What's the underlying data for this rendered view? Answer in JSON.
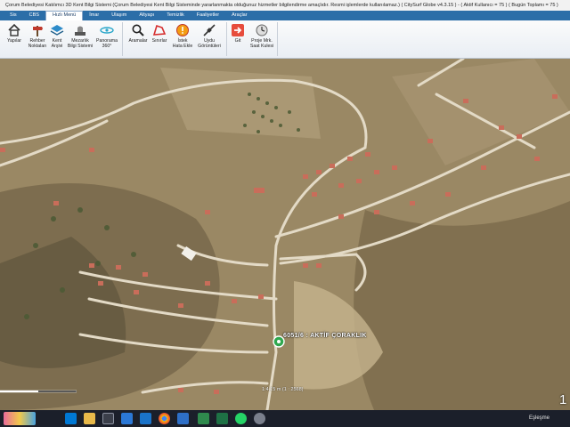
{
  "window": {
    "title": "Çorum Belediyesi Katılımcı 3D Kent Bilgi Sistemi (Çorum Belediyesi Kent Bilgi Sisteminde yararlanmakta olduğunuz hizmetler bilgilendirme amaçlıdır. Resmi işlemlerde kullanılamaz.)  ( CitySurf Globe v4.3.15 ) - ( Aktif Kullanıcı = 75 )  ( Bugün Toplamı = 75 )"
  },
  "menu": {
    "items": [
      "Sis",
      "CBS",
      "Hızlı Menü",
      "İmar",
      "Ulaşım",
      "Altyapı",
      "Temizlik",
      "Faaliyetler",
      "Araçlar"
    ],
    "active_index": 2
  },
  "ribbon": {
    "buttons": [
      {
        "label": "Yapılar",
        "icon": "house-icon"
      },
      {
        "label": "Rehber\nNoktaları",
        "icon": "signpost-icon"
      },
      {
        "label": "Kent\nArşivi",
        "icon": "layers-icon"
      },
      {
        "label": "Mezarlık\nBilgi Sistemi",
        "icon": "cemetery-icon"
      },
      {
        "label": "Panorama\n360°",
        "icon": "panorama-icon"
      },
      {
        "label": "Aramalar",
        "icon": "magnifier-icon"
      },
      {
        "label": "Sınırlar",
        "icon": "boundary-icon"
      },
      {
        "label": "İstek\nHata Ekle",
        "icon": "warning-icon"
      },
      {
        "label": "Uydu\nGörüntüleri",
        "icon": "satellite-icon"
      },
      {
        "label": "Git",
        "icon": "goto-arrow-icon"
      },
      {
        "label": "Proje Mrk.\nSaat Kulesi",
        "icon": "clock-tower-icon"
      }
    ]
  },
  "map": {
    "marker_label": "6051/6 : AKTİF ÇORAKLIK",
    "scale_text": "1:4,15 m    (1 : 2568)",
    "corner_number": "1"
  },
  "taskbar": {
    "status_text": "Eşleşme",
    "apps": [
      "windows-icon",
      "search-icon",
      "task-view-icon",
      "file-explorer-icon",
      "store-icon",
      "mail-icon",
      "chrome-icon",
      "photos-icon",
      "excel-icon",
      "whatsapp-icon",
      "settings-icon"
    ]
  },
  "colors": {
    "menubar": "#2c6ea8",
    "taskbar": "#1b1f2a",
    "marker": "#2fa84f"
  }
}
